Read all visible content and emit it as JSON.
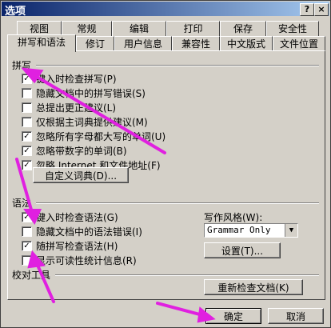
{
  "window": {
    "title": "选项",
    "help_btn": "?",
    "close_btn": "×"
  },
  "tabs_top": [
    {
      "label": "视图"
    },
    {
      "label": "常规"
    },
    {
      "label": "编辑"
    },
    {
      "label": "打印"
    },
    {
      "label": "保存"
    },
    {
      "label": "安全性"
    }
  ],
  "tabs_bottom": [
    {
      "label": "拼写和语法"
    },
    {
      "label": "修订"
    },
    {
      "label": "用户信息"
    },
    {
      "label": "兼容性"
    },
    {
      "label": "中文版式"
    },
    {
      "label": "文件位置"
    }
  ],
  "spelling": {
    "heading": "拼写",
    "items": [
      {
        "label": "键入时检查拼写(P)",
        "checked": true
      },
      {
        "label": "隐藏文档中的拼写错误(S)",
        "checked": false
      },
      {
        "label": "总提出更正建议(L)",
        "checked": false
      },
      {
        "label": "仅根据主词典提供建议(M)",
        "checked": false
      },
      {
        "label": "忽略所有字母都大写的单词(U)",
        "checked": true
      },
      {
        "label": "忽略带数字的单词(B)",
        "checked": true
      },
      {
        "label": "忽略 Internet 和文件地址(F)",
        "checked": true
      }
    ],
    "custom_dict_btn": "自定义词典(D)..."
  },
  "grammar": {
    "heading": "语法",
    "items": [
      {
        "label": "键入时检查语法(G)",
        "checked": true
      },
      {
        "label": "隐藏文档中的语法错误(I)",
        "checked": false
      },
      {
        "label": "随拼写检查语法(H)",
        "checked": true
      },
      {
        "label": "显示可读性统计信息(R)",
        "checked": false
      }
    ],
    "style_label": "写作风格(W):",
    "style_value": "Grammar Only",
    "settings_btn": "设置(T)..."
  },
  "proofing": {
    "heading": "校对工具",
    "recheck_btn": "重新检查文档(K)"
  },
  "footer": {
    "ok_btn": "确定",
    "cancel_btn": "取消"
  },
  "colors": {
    "annotation_arrow": "#e020e0",
    "titlebar": "#0a246a"
  }
}
